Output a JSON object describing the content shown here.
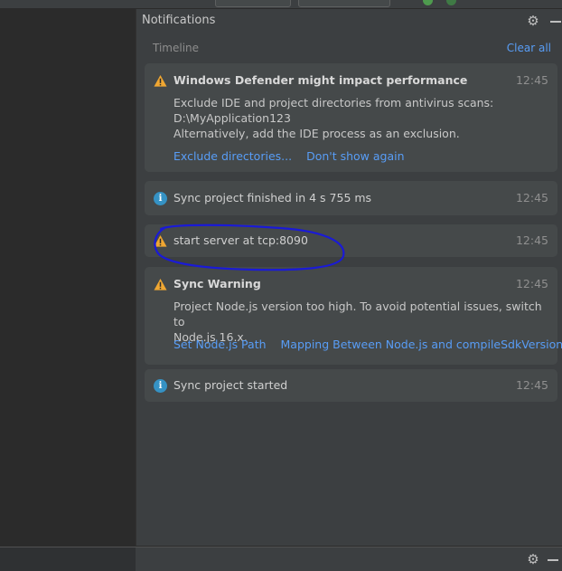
{
  "panel": {
    "title": "Notifications",
    "timeline_label": "Timeline",
    "clear_all_label": "Clear all"
  },
  "notifications": [
    {
      "type": "warning",
      "title": "Windows Defender might impact performance",
      "time": "12:45",
      "body": "Exclude IDE and project directories from antivirus scans:\nD:\\MyApplication123\nAlternatively, add the IDE process as an exclusion.",
      "links": [
        "Exclude directories...",
        "Don't show again"
      ]
    },
    {
      "type": "info",
      "title": "Sync project finished in 4 s 755 ms",
      "time": "12:45"
    },
    {
      "type": "warning",
      "title": "start server at tcp:8090",
      "time": "12:45"
    },
    {
      "type": "warning",
      "title": "Sync Warning",
      "time": "12:45",
      "body": "Project Node.js version too high. To avoid potential issues, switch to\nNode.js 16.x.",
      "links": [
        "Set Node.js Path",
        "Mapping Between Node.js and compileSdkVersion"
      ]
    },
    {
      "type": "info",
      "title": "Sync project started",
      "time": "12:45"
    }
  ],
  "icons": {
    "settings": "gear-icon",
    "hide": "minus-icon",
    "warning": "warning-icon",
    "info": "info-icon"
  },
  "colors": {
    "link": "#589df6",
    "warning": "#f0a732",
    "info": "#3592c4",
    "annotation_ink": "#1a1ad6"
  }
}
